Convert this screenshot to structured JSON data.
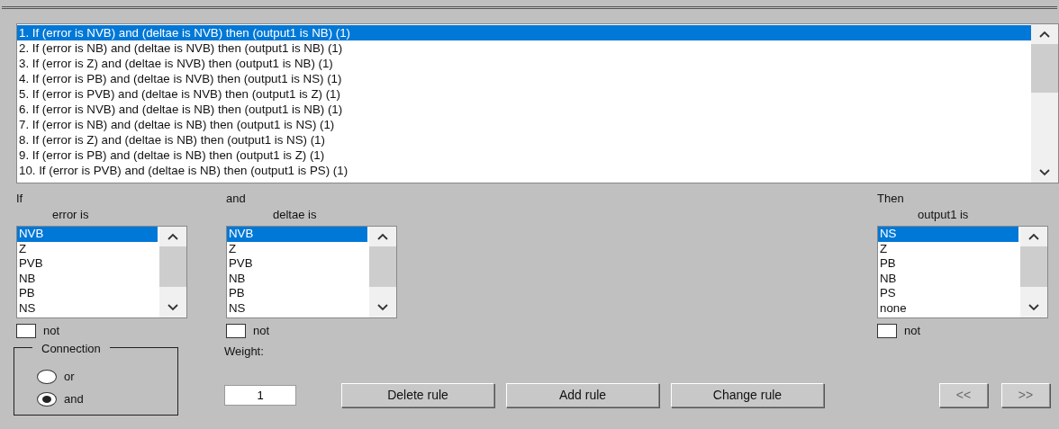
{
  "rules": [
    {
      "text": "1. If (error is NVB) and (deltae is NVB) then (output1 is NB) (1)",
      "selected": true
    },
    {
      "text": "2. If (error is NB) and (deltae is NVB) then (output1 is NB) (1)",
      "selected": false
    },
    {
      "text": "3. If (error is Z) and (deltae is NVB) then (output1 is NB) (1)",
      "selected": false
    },
    {
      "text": "4. If (error is PB) and (deltae is NVB) then (output1 is NS) (1)",
      "selected": false
    },
    {
      "text": "5. If (error is PVB) and (deltae is NVB) then (output1 is Z) (1)",
      "selected": false
    },
    {
      "text": "6. If (error is NVB) and (deltae is NB) then (output1 is NB) (1)",
      "selected": false
    },
    {
      "text": "7. If (error is NB) and (deltae is NB) then (output1 is NS) (1)",
      "selected": false
    },
    {
      "text": "8. If (error is Z) and (deltae is NB) then (output1 is NS) (1)",
      "selected": false
    },
    {
      "text": "9. If (error is PB) and (deltae is NB) then (output1 is Z) (1)",
      "selected": false
    },
    {
      "text": "10. If (error is PVB) and (deltae is NB) then (output1 is PS) (1)",
      "selected": false
    }
  ],
  "variables": [
    {
      "heading": "If",
      "label": "error is",
      "not_label": "not",
      "not_checked": false,
      "items": [
        {
          "text": "NVB",
          "selected": true
        },
        {
          "text": "Z",
          "selected": false
        },
        {
          "text": "PVB",
          "selected": false
        },
        {
          "text": "NB",
          "selected": false
        },
        {
          "text": "PB",
          "selected": false
        },
        {
          "text": "NS",
          "selected": false
        }
      ]
    },
    {
      "heading": "and",
      "label": "deltae is",
      "not_label": "not",
      "not_checked": false,
      "items": [
        {
          "text": "NVB",
          "selected": true
        },
        {
          "text": "Z",
          "selected": false
        },
        {
          "text": "PVB",
          "selected": false
        },
        {
          "text": "NB",
          "selected": false
        },
        {
          "text": "PB",
          "selected": false
        },
        {
          "text": "NS",
          "selected": false
        }
      ]
    },
    {
      "heading": "Then",
      "label": "output1 is",
      "not_label": "not",
      "not_checked": false,
      "items": [
        {
          "text": "NS",
          "selected": true
        },
        {
          "text": "Z",
          "selected": false
        },
        {
          "text": "PB",
          "selected": false
        },
        {
          "text": "NB",
          "selected": false
        },
        {
          "text": "PS",
          "selected": false
        },
        {
          "text": "none",
          "selected": false
        }
      ]
    }
  ],
  "connection": {
    "title": "Connection",
    "options": [
      {
        "label": "or",
        "selected": false
      },
      {
        "label": "and",
        "selected": true
      }
    ]
  },
  "weight": {
    "label": "Weight:",
    "value": "1"
  },
  "buttons": [
    {
      "label": "Delete rule",
      "disabled": false
    },
    {
      "label": "Add rule",
      "disabled": false
    },
    {
      "label": "Change rule",
      "disabled": false
    }
  ],
  "nav_buttons": [
    {
      "label": "<<",
      "disabled": true
    },
    {
      "label": ">>",
      "disabled": true
    }
  ]
}
